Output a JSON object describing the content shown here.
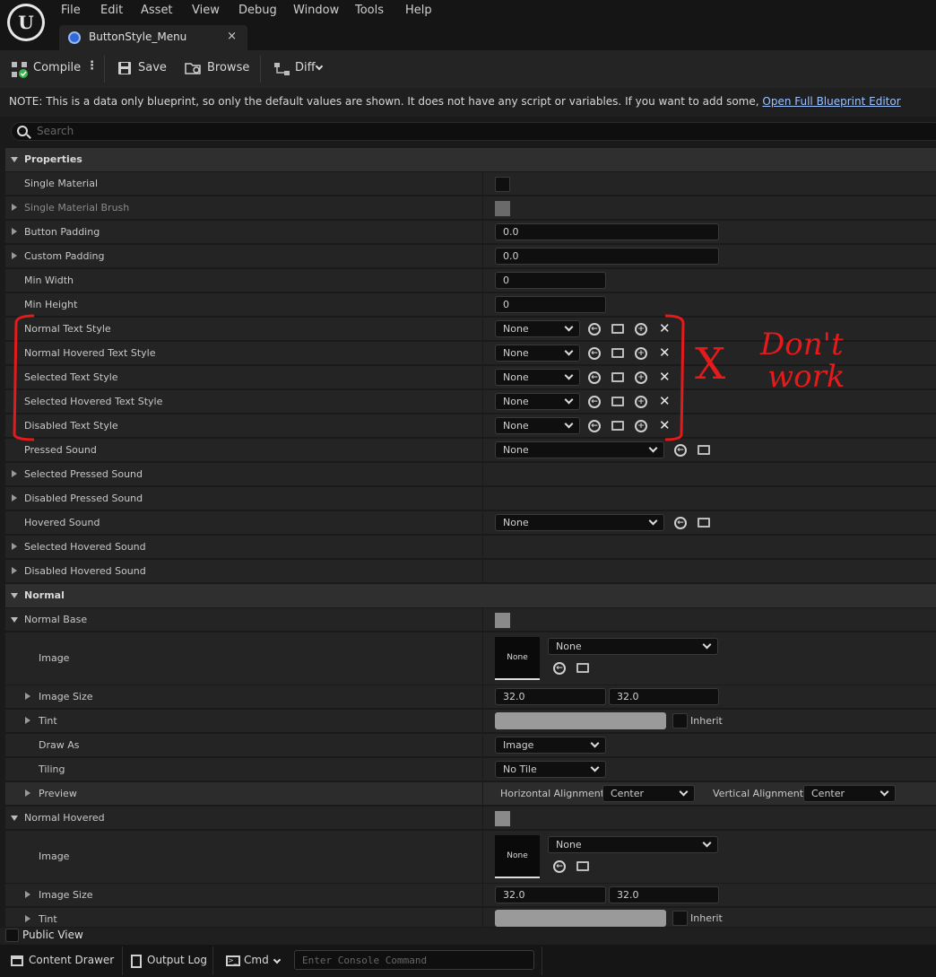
{
  "menu": [
    "File",
    "Edit",
    "Asset",
    "View",
    "Debug",
    "Window",
    "Tools",
    "Help"
  ],
  "tab": {
    "label": "ButtonStyle_Menu",
    "close": "×"
  },
  "toolbar": {
    "compile": "Compile",
    "save": "Save",
    "browse": "Browse",
    "diff": "Diff"
  },
  "note": {
    "text": "NOTE: This is a data only blueprint, so only the default values are shown.  It does not have any script or variables.  If you want to add some,",
    "link": "Open Full Blueprint Editor"
  },
  "search_placeholder": "Search",
  "properties": {
    "title": "Properties",
    "single_material": "Single Material",
    "single_material_brush": "Single Material Brush",
    "button_padding": "Button Padding",
    "button_padding_value": "0.0",
    "custom_padding": "Custom Padding",
    "custom_padding_value": "0.0",
    "min_width": "Min Width",
    "min_width_value": "0",
    "min_height": "Min Height",
    "min_height_value": "0",
    "text_styles": [
      {
        "label": "Normal Text Style",
        "value": "None"
      },
      {
        "label": "Normal Hovered Text Style",
        "value": "None"
      },
      {
        "label": "Selected Text Style",
        "value": "None"
      },
      {
        "label": "Selected Hovered Text Style",
        "value": "None"
      },
      {
        "label": "Disabled Text Style",
        "value": "None"
      }
    ],
    "pressed_sound": "Pressed Sound",
    "pressed_sound_value": "None",
    "selected_pressed_sound": "Selected Pressed Sound",
    "disabled_pressed_sound": "Disabled Pressed Sound",
    "hovered_sound": "Hovered Sound",
    "hovered_sound_value": "None",
    "selected_hovered_sound": "Selected Hovered Sound",
    "disabled_hovered_sound": "Disabled Hovered Sound"
  },
  "normal": {
    "title": "Normal",
    "base": {
      "label": "Normal Base",
      "image": "Image",
      "thumb": "None",
      "image_value": "None",
      "image_size": "Image Size",
      "size_x": "32.0",
      "size_y": "32.0",
      "tint": "Tint",
      "inherit": "Inherit",
      "draw_as": "Draw As",
      "draw_as_value": "Image",
      "tiling": "Tiling",
      "tiling_value": "No Tile",
      "preview": "Preview",
      "h_align": "Horizontal Alignment",
      "h_align_value": "Center",
      "v_align": "Vertical Alignment",
      "v_align_value": "Center"
    },
    "hovered": {
      "label": "Normal Hovered",
      "image": "Image",
      "thumb": "None",
      "image_value": "None",
      "image_size": "Image Size",
      "size_x": "32.0",
      "size_y": "32.0",
      "tint": "Tint",
      "inherit": "Inherit"
    }
  },
  "public_view": "Public View",
  "bottom": {
    "content_drawer": "Content Drawer",
    "output_log": "Output Log",
    "cmd": "Cmd",
    "console_placeholder": "Enter Console Command"
  },
  "annotation": {
    "x": "X",
    "line1": "Don't",
    "line2": "work",
    "color": "#e51a1a"
  }
}
